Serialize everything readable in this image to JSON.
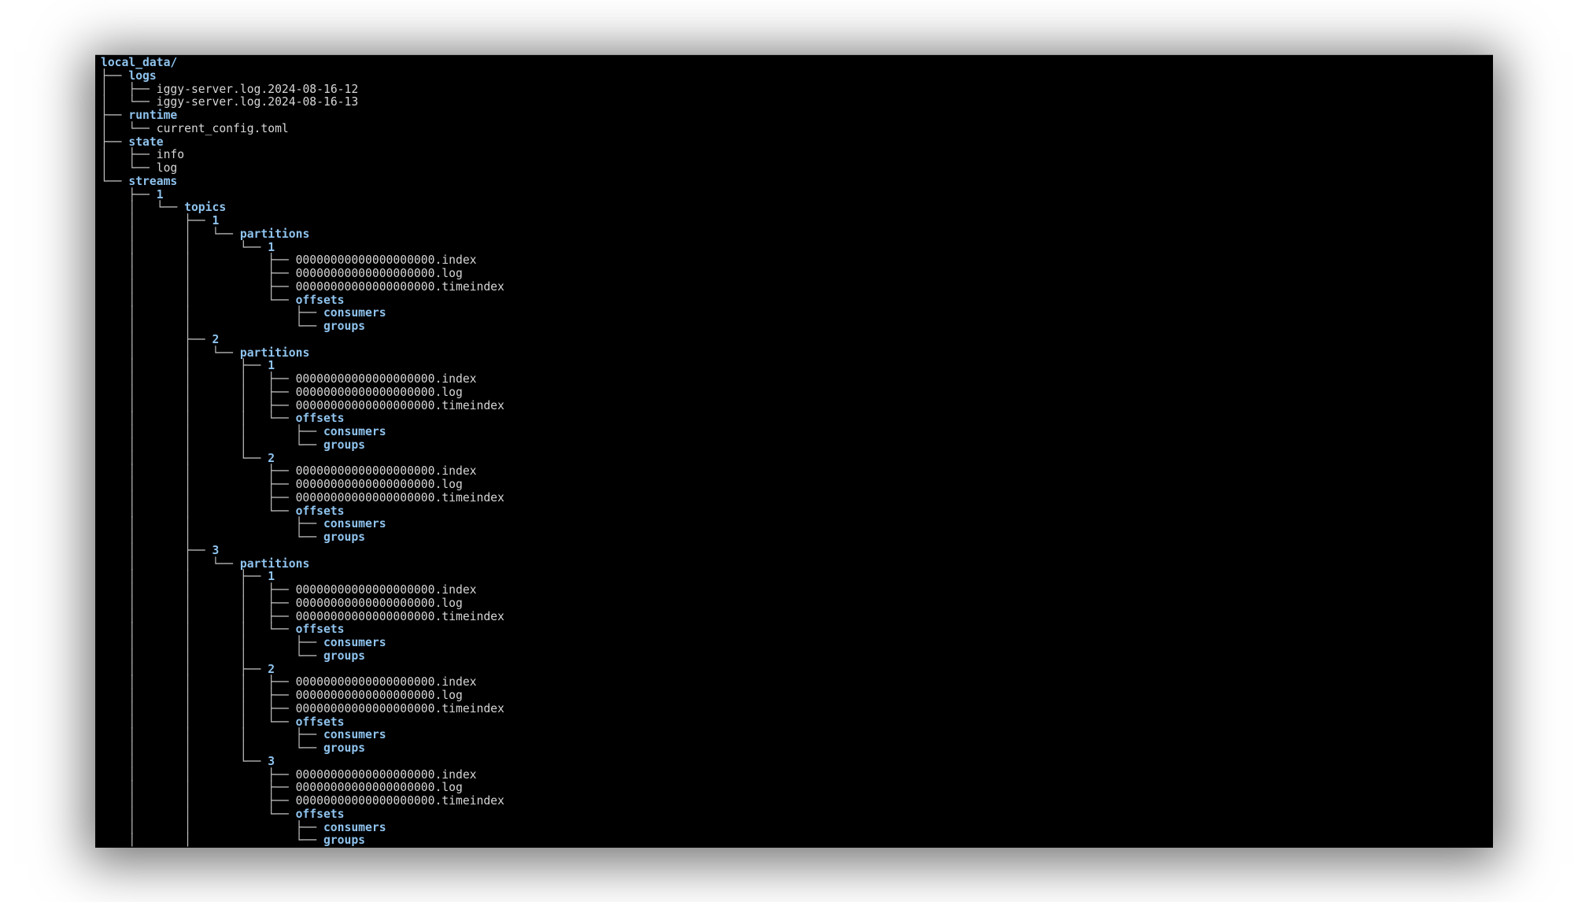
{
  "window": {
    "type": "terminal",
    "content": "tree output of local_data directory"
  },
  "colors": {
    "background": "#000000",
    "directory": "#8fc3ee",
    "file": "#d6d6d6",
    "tree_lines": "#c4c4c4"
  },
  "tree": [
    {
      "prefix": "",
      "name": "local_data/",
      "kind": "dir"
    },
    {
      "prefix": "├── ",
      "name": "logs",
      "kind": "dir"
    },
    {
      "prefix": "│   ├── ",
      "name": "iggy-server.log.2024-08-16-12",
      "kind": "file"
    },
    {
      "prefix": "│   └── ",
      "name": "iggy-server.log.2024-08-16-13",
      "kind": "file"
    },
    {
      "prefix": "├── ",
      "name": "runtime",
      "kind": "dir"
    },
    {
      "prefix": "│   └── ",
      "name": "current_config.toml",
      "kind": "file"
    },
    {
      "prefix": "├── ",
      "name": "state",
      "kind": "dir"
    },
    {
      "prefix": "│   ├── ",
      "name": "info",
      "kind": "file"
    },
    {
      "prefix": "│   └── ",
      "name": "log",
      "kind": "file"
    },
    {
      "prefix": "└── ",
      "name": "streams",
      "kind": "dir"
    },
    {
      "prefix": "    ├── ",
      "name": "1",
      "kind": "dir"
    },
    {
      "prefix": "    │   └── ",
      "name": "topics",
      "kind": "dir"
    },
    {
      "prefix": "    │       ├── ",
      "name": "1",
      "kind": "dir"
    },
    {
      "prefix": "    │       │   └── ",
      "name": "partitions",
      "kind": "dir"
    },
    {
      "prefix": "    │       │       └── ",
      "name": "1",
      "kind": "dir"
    },
    {
      "prefix": "    │       │           ├── ",
      "name": "00000000000000000000.index",
      "kind": "file"
    },
    {
      "prefix": "    │       │           ├── ",
      "name": "00000000000000000000.log",
      "kind": "file"
    },
    {
      "prefix": "    │       │           ├── ",
      "name": "00000000000000000000.timeindex",
      "kind": "file"
    },
    {
      "prefix": "    │       │           └── ",
      "name": "offsets",
      "kind": "dir"
    },
    {
      "prefix": "    │       │               ├── ",
      "name": "consumers",
      "kind": "dir"
    },
    {
      "prefix": "    │       │               └── ",
      "name": "groups",
      "kind": "dir"
    },
    {
      "prefix": "    │       ├── ",
      "name": "2",
      "kind": "dir"
    },
    {
      "prefix": "    │       │   └── ",
      "name": "partitions",
      "kind": "dir"
    },
    {
      "prefix": "    │       │       ├── ",
      "name": "1",
      "kind": "dir"
    },
    {
      "prefix": "    │       │       │   ├── ",
      "name": "00000000000000000000.index",
      "kind": "file"
    },
    {
      "prefix": "    │       │       │   ├── ",
      "name": "00000000000000000000.log",
      "kind": "file"
    },
    {
      "prefix": "    │       │       │   ├── ",
      "name": "00000000000000000000.timeindex",
      "kind": "file"
    },
    {
      "prefix": "    │       │       │   └── ",
      "name": "offsets",
      "kind": "dir"
    },
    {
      "prefix": "    │       │       │       ├── ",
      "name": "consumers",
      "kind": "dir"
    },
    {
      "prefix": "    │       │       │       └── ",
      "name": "groups",
      "kind": "dir"
    },
    {
      "prefix": "    │       │       └── ",
      "name": "2",
      "kind": "dir"
    },
    {
      "prefix": "    │       │           ├── ",
      "name": "00000000000000000000.index",
      "kind": "file"
    },
    {
      "prefix": "    │       │           ├── ",
      "name": "00000000000000000000.log",
      "kind": "file"
    },
    {
      "prefix": "    │       │           ├── ",
      "name": "00000000000000000000.timeindex",
      "kind": "file"
    },
    {
      "prefix": "    │       │           └── ",
      "name": "offsets",
      "kind": "dir"
    },
    {
      "prefix": "    │       │               ├── ",
      "name": "consumers",
      "kind": "dir"
    },
    {
      "prefix": "    │       │               └── ",
      "name": "groups",
      "kind": "dir"
    },
    {
      "prefix": "    │       ├── ",
      "name": "3",
      "kind": "dir"
    },
    {
      "prefix": "    │       │   └── ",
      "name": "partitions",
      "kind": "dir"
    },
    {
      "prefix": "    │       │       ├── ",
      "name": "1",
      "kind": "dir"
    },
    {
      "prefix": "    │       │       │   ├── ",
      "name": "00000000000000000000.index",
      "kind": "file"
    },
    {
      "prefix": "    │       │       │   ├── ",
      "name": "00000000000000000000.log",
      "kind": "file"
    },
    {
      "prefix": "    │       │       │   ├── ",
      "name": "00000000000000000000.timeindex",
      "kind": "file"
    },
    {
      "prefix": "    │       │       │   └── ",
      "name": "offsets",
      "kind": "dir"
    },
    {
      "prefix": "    │       │       │       ├── ",
      "name": "consumers",
      "kind": "dir"
    },
    {
      "prefix": "    │       │       │       └── ",
      "name": "groups",
      "kind": "dir"
    },
    {
      "prefix": "    │       │       ├── ",
      "name": "2",
      "kind": "dir"
    },
    {
      "prefix": "    │       │       │   ├── ",
      "name": "00000000000000000000.index",
      "kind": "file"
    },
    {
      "prefix": "    │       │       │   ├── ",
      "name": "00000000000000000000.log",
      "kind": "file"
    },
    {
      "prefix": "    │       │       │   ├── ",
      "name": "00000000000000000000.timeindex",
      "kind": "file"
    },
    {
      "prefix": "    │       │       │   └── ",
      "name": "offsets",
      "kind": "dir"
    },
    {
      "prefix": "    │       │       │       ├── ",
      "name": "consumers",
      "kind": "dir"
    },
    {
      "prefix": "    │       │       │       └── ",
      "name": "groups",
      "kind": "dir"
    },
    {
      "prefix": "    │       │       └── ",
      "name": "3",
      "kind": "dir"
    },
    {
      "prefix": "    │       │           ├── ",
      "name": "00000000000000000000.index",
      "kind": "file"
    },
    {
      "prefix": "    │       │           ├── ",
      "name": "00000000000000000000.log",
      "kind": "file"
    },
    {
      "prefix": "    │       │           ├── ",
      "name": "00000000000000000000.timeindex",
      "kind": "file"
    },
    {
      "prefix": "    │       │           └── ",
      "name": "offsets",
      "kind": "dir"
    },
    {
      "prefix": "    │       │               ├── ",
      "name": "consumers",
      "kind": "dir"
    },
    {
      "prefix": "    │       │               └── ",
      "name": "groups",
      "kind": "dir"
    }
  ]
}
